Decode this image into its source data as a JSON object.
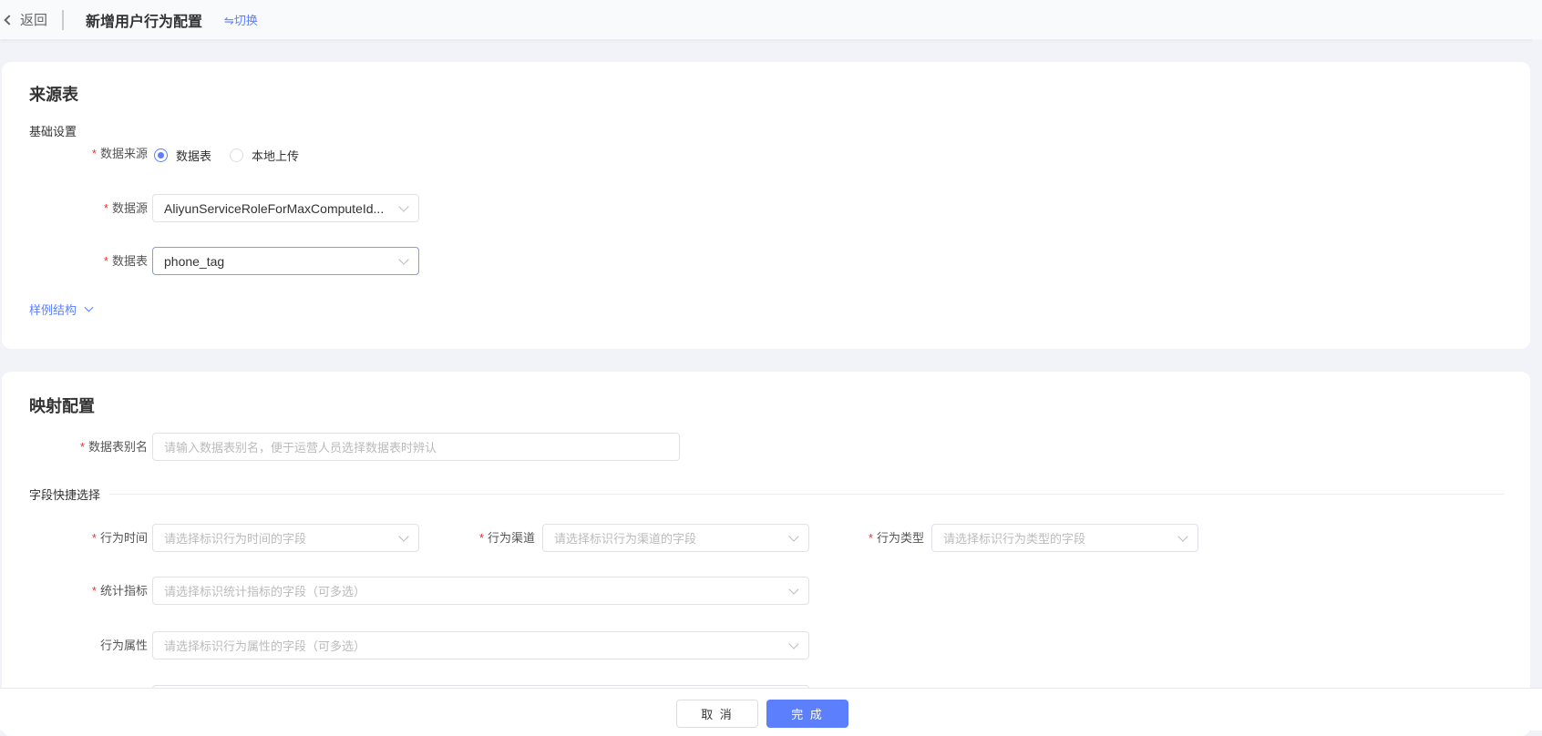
{
  "header": {
    "back_label": "返回",
    "title": "新增用户行为配置",
    "switch_label": "⇋切换"
  },
  "source": {
    "title": "来源表",
    "section": "基础设置",
    "data_source_type": {
      "label": "数据来源",
      "options": [
        "数据表",
        "本地上传"
      ],
      "selected": "数据表"
    },
    "datasource": {
      "label": "数据源",
      "value": "AliyunServiceRoleForMaxComputeId..."
    },
    "table": {
      "label": "数据表",
      "value": "phone_tag"
    },
    "sample_link": "样例结构"
  },
  "mapping": {
    "title": "映射配置",
    "alias": {
      "label": "数据表别名",
      "placeholder": "请输入数据表别名，便于运营人员选择数据表时辨认"
    },
    "section": "字段快捷选择",
    "fields": [
      {
        "label": "行为时间",
        "placeholder": "请选择标识行为时间的字段",
        "required": true
      },
      {
        "label": "行为渠道",
        "placeholder": "请选择标识行为渠道的字段",
        "required": true
      },
      {
        "label": "行为类型",
        "placeholder": "请选择标识行为类型的字段",
        "required": true
      },
      {
        "label": "统计指标",
        "placeholder": "请选择标识统计指标的字段（可多选）",
        "required": true
      },
      {
        "label": "行为属性",
        "placeholder": "请选择标识行为属性的字段（可多选）",
        "required": false
      }
    ]
  },
  "footer": {
    "cancel": "取 消",
    "ok": "完 成"
  },
  "colors": {
    "accent": "#5b7ffd",
    "required": "#e33333",
    "background": "#f2f3f8"
  }
}
